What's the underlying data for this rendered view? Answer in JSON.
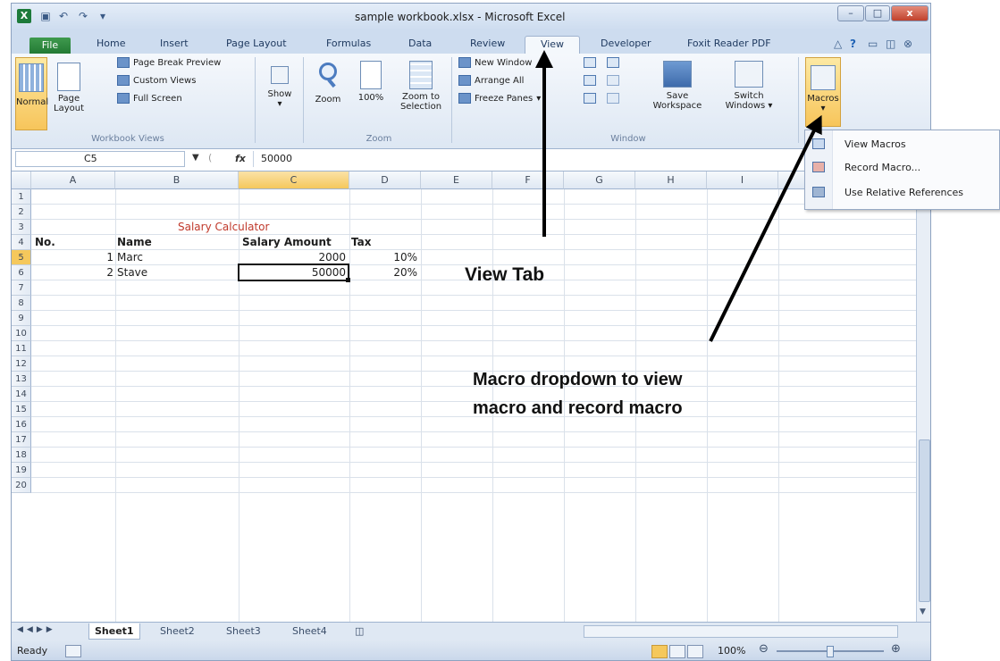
{
  "window": {
    "title": "sample workbook.xlsx - Microsoft Excel",
    "app_icon": "X"
  },
  "quick_access": {
    "save_icon": "save-icon",
    "undo_icon": "undo-icon",
    "redo_icon": "redo-icon"
  },
  "tabs": [
    {
      "id": "file",
      "label": "File"
    },
    {
      "id": "home",
      "label": "Home"
    },
    {
      "id": "insert",
      "label": "Insert"
    },
    {
      "id": "page-layout",
      "label": "Page Layout"
    },
    {
      "id": "formulas",
      "label": "Formulas"
    },
    {
      "id": "data",
      "label": "Data"
    },
    {
      "id": "review",
      "label": "Review"
    },
    {
      "id": "view",
      "label": "View"
    },
    {
      "id": "developer",
      "label": "Developer"
    },
    {
      "id": "foxit",
      "label": "Foxit Reader PDF"
    }
  ],
  "ribbon": {
    "workbook_views": {
      "normal": "Normal",
      "page_layout_1": "Page",
      "page_layout_2": "Layout",
      "page_break_preview": "Page Break Preview",
      "custom_views": "Custom Views",
      "full_screen": "Full Screen",
      "group_label": "Workbook Views"
    },
    "show": {
      "label": "Show"
    },
    "zoom": {
      "zoom": "Zoom",
      "hundred": "100%",
      "zoom_to_selection_1": "Zoom to",
      "zoom_to_selection_2": "Selection",
      "group_label": "Zoom"
    },
    "window": {
      "new_window": "New Window",
      "arrange_all": "Arrange All",
      "freeze_panes": "Freeze Panes",
      "save_workspace_1": "Save",
      "save_workspace_2": "Workspace",
      "switch_windows_1": "Switch",
      "switch_windows_2": "Windows",
      "group_label": "Window"
    },
    "macros": {
      "label": "Macros"
    }
  },
  "formula_bar": {
    "name_box": "C5",
    "fx": "fx",
    "value": "50000"
  },
  "columns": [
    "A",
    "B",
    "C",
    "D",
    "E",
    "F",
    "G",
    "H",
    "I"
  ],
  "rows": [
    "1",
    "2",
    "3",
    "4",
    "5",
    "6",
    "7",
    "8",
    "9",
    "10",
    "11",
    "12",
    "13",
    "14",
    "15",
    "16",
    "17",
    "18",
    "19",
    "20"
  ],
  "cells": {
    "title": "Salary Calculator",
    "h_no": "No.",
    "h_name": "Name",
    "h_salary": "Salary Amount",
    "h_tax": "Tax",
    "r4_no": "1",
    "r4_name": "Marc",
    "r4_salary": "2000",
    "r4_tax": "10%",
    "r5_no": "2",
    "r5_name": "Stave",
    "r5_salary": "50000",
    "r5_tax": "20%"
  },
  "sheets": [
    "Sheet1",
    "Sheet2",
    "Sheet3",
    "Sheet4"
  ],
  "status": {
    "ready": "Ready",
    "zoom": "100%"
  },
  "macro_menu": {
    "items": [
      {
        "label": "View Macros"
      },
      {
        "label": "Record Macro..."
      },
      {
        "label": "Use Relative References"
      }
    ]
  },
  "annotations": {
    "view_tab": "View Tab",
    "macro_line1": "Macro dropdown to view",
    "macro_line2": "macro and record macro"
  },
  "colors": {
    "accent_tab_file": "#2e8a3f",
    "selected_header": "#f5c85c",
    "title_text": "#c0392b"
  }
}
